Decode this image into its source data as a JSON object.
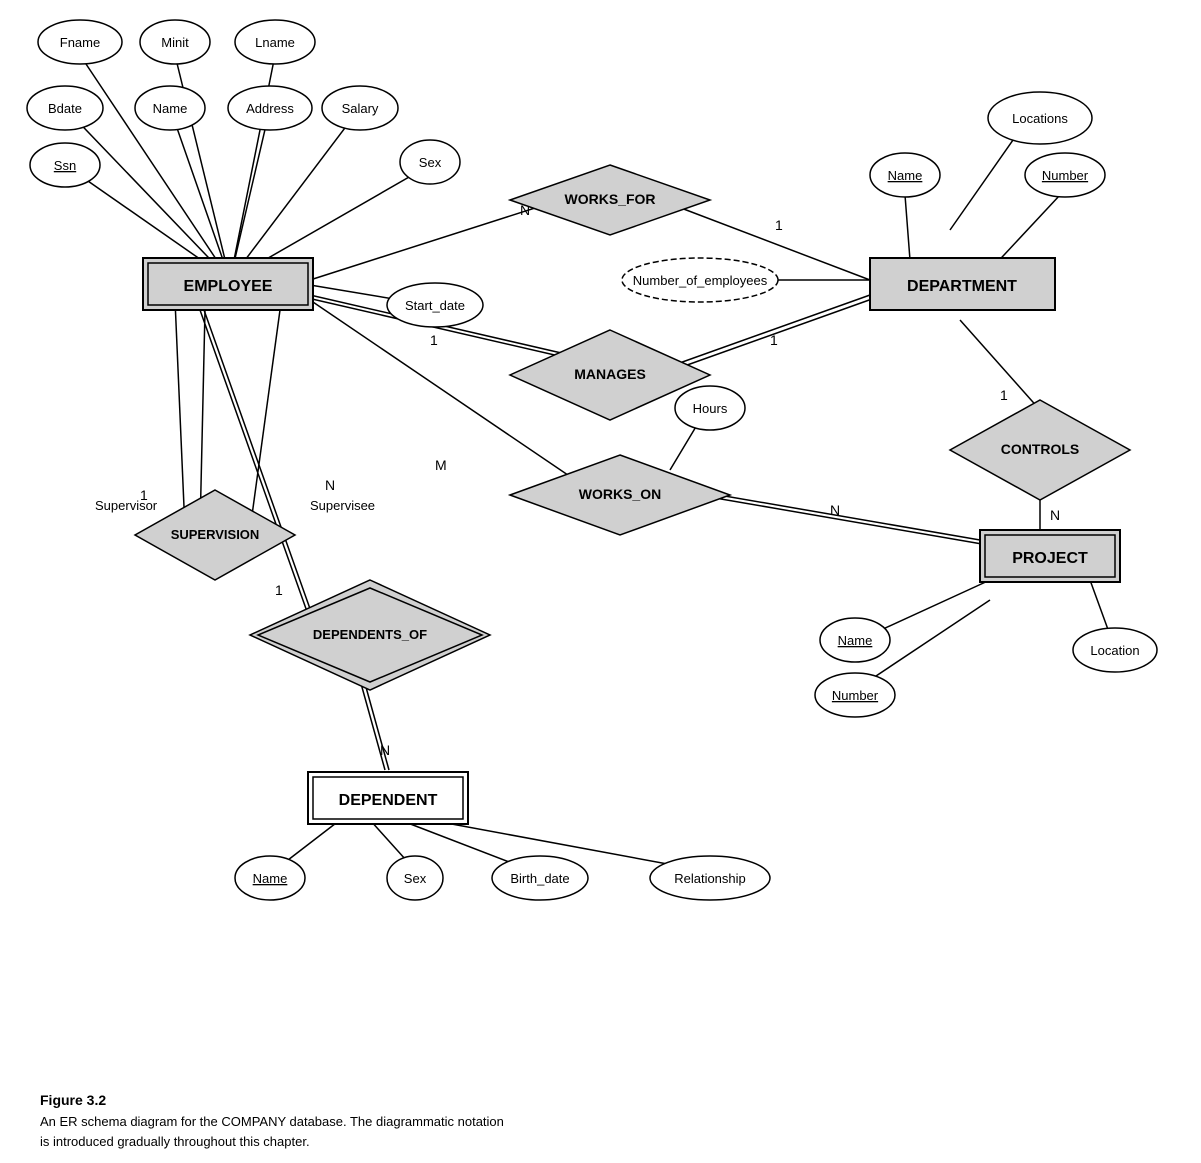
{
  "caption": {
    "title": "Figure 3.2",
    "line1": "An ER schema diagram for the COMPANY database. The diagrammatic notation",
    "line2": "is introduced gradually throughout this chapter."
  },
  "entities": {
    "employee": "EMPLOYEE",
    "department": "DEPARTMENT",
    "project": "PROJECT",
    "dependent": "DEPENDENT"
  },
  "relationships": {
    "works_for": "WORKS_FOR",
    "manages": "MANAGES",
    "works_on": "WORKS_ON",
    "controls": "CONTROLS",
    "supervision": "SUPERVISION",
    "dependents_of": "DEPENDENTS_OF"
  },
  "attributes": {
    "fname": "Fname",
    "minit": "Minit",
    "lname": "Lname",
    "bdate": "Bdate",
    "name_emp": "Name",
    "address": "Address",
    "salary": "Salary",
    "ssn": "Ssn",
    "sex_emp": "Sex",
    "start_date": "Start_date",
    "num_employees": "Number_of_employees",
    "locations": "Locations",
    "dept_name": "Name",
    "dept_number": "Number",
    "hours": "Hours",
    "proj_name": "Name",
    "proj_number": "Number",
    "proj_location": "Location",
    "dep_name": "Name",
    "dep_sex": "Sex",
    "dep_birthdate": "Birth_date",
    "dep_relationship": "Relationship"
  },
  "cardinalities": {
    "works_for_emp": "N",
    "works_for_dept": "1",
    "manages_emp": "1",
    "manages_dept": "1",
    "works_on_emp": "M",
    "works_on_proj": "N",
    "controls_dept": "1",
    "controls_proj": "N",
    "supervision_supervisor": "1",
    "supervision_supervisee": "N",
    "dependents_emp": "1",
    "dependents_dep": "N"
  }
}
